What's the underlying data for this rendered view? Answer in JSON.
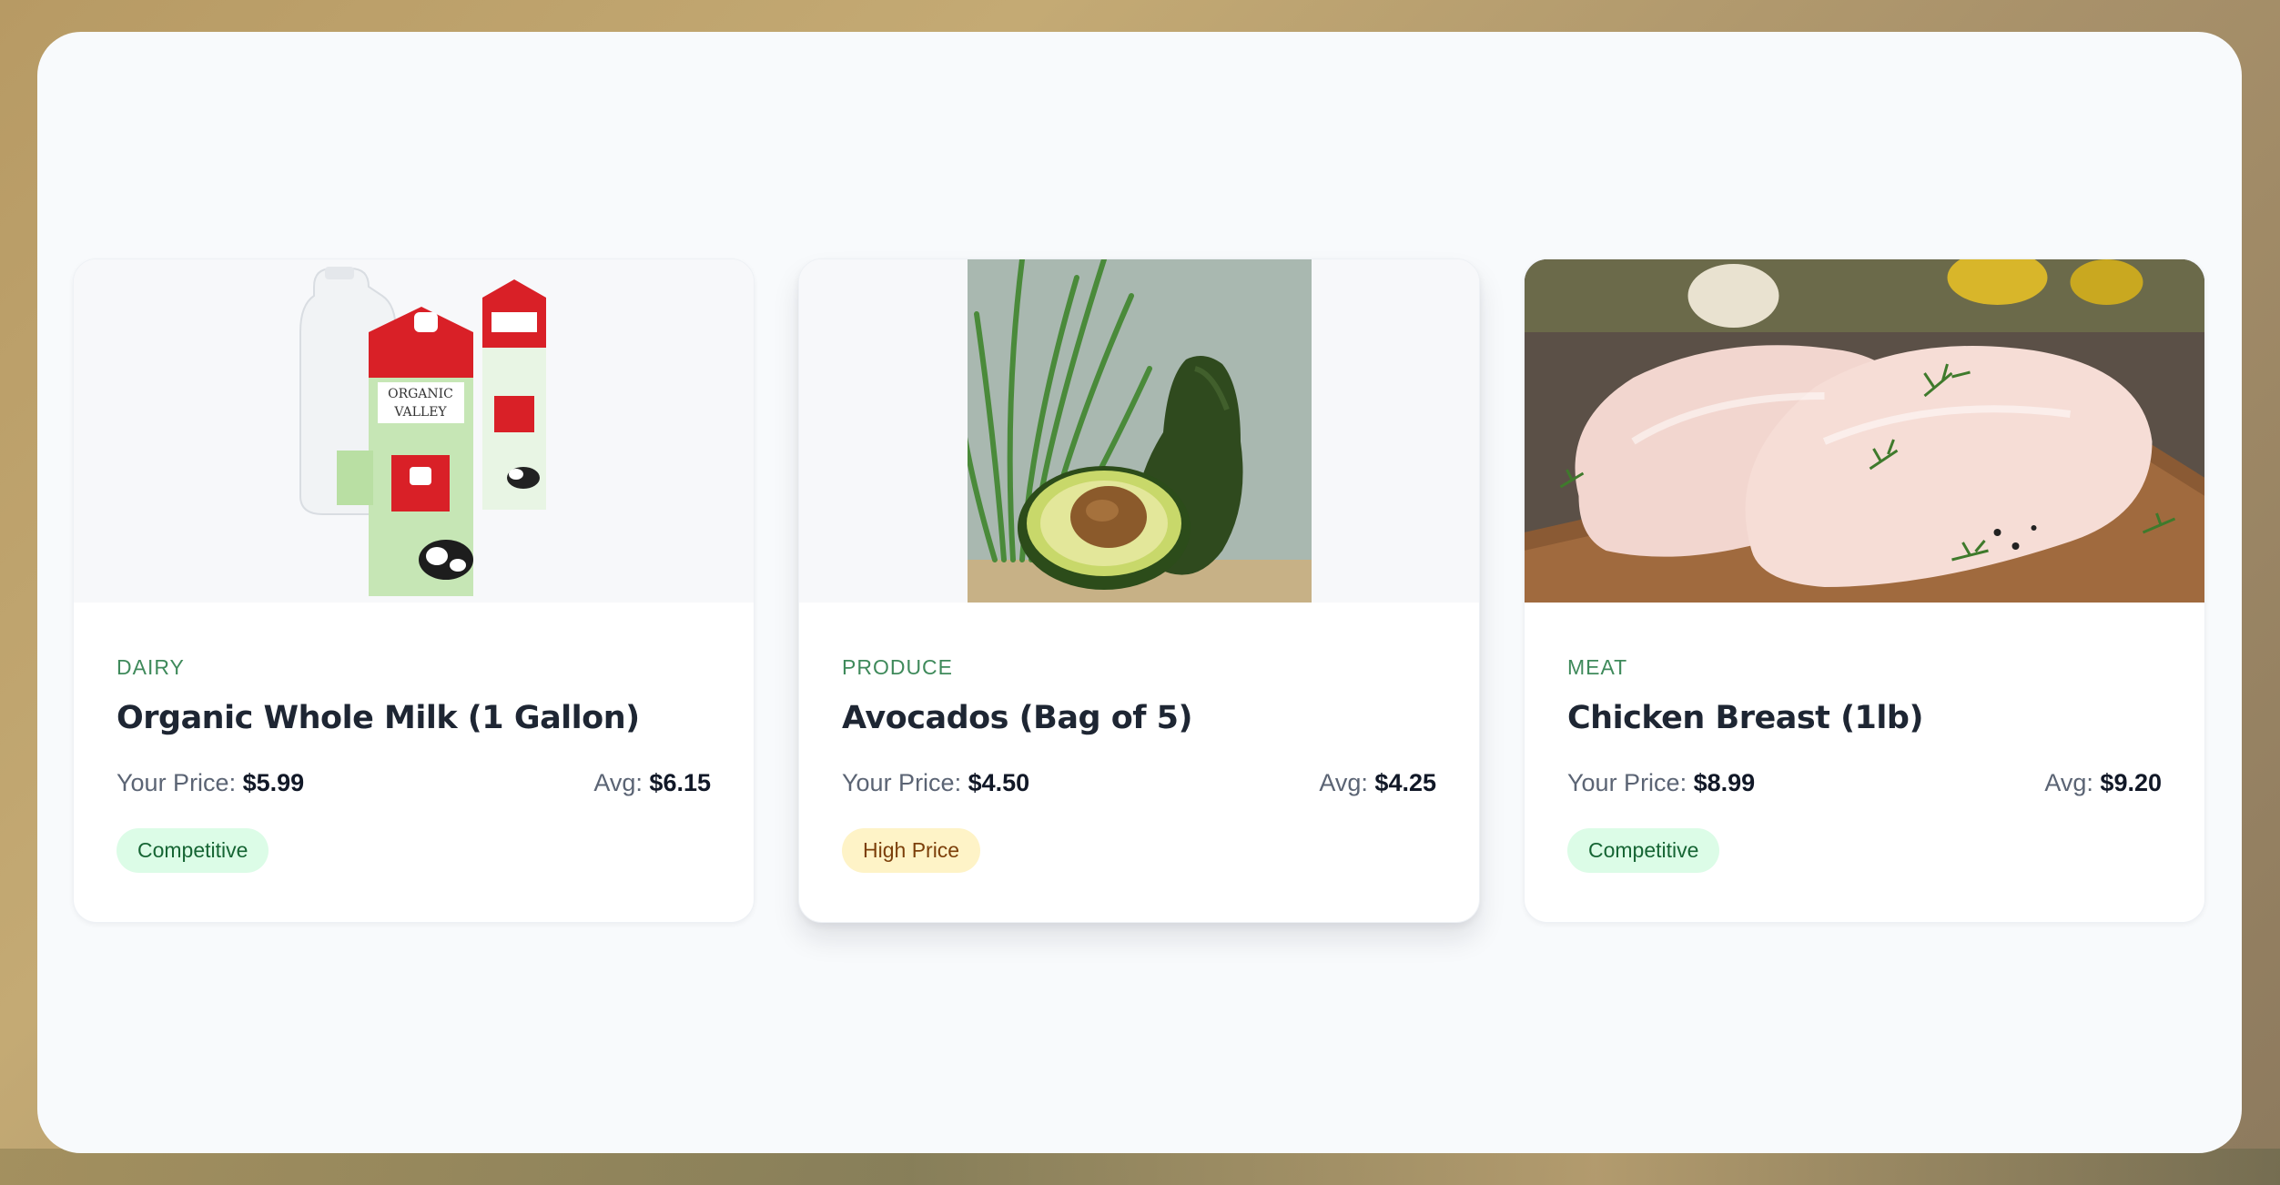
{
  "products": [
    {
      "category": "DAIRY",
      "name": "Organic Whole Milk (1 Gallon)",
      "your_price_label": "Your Price:",
      "your_price": "$5.99",
      "avg_label": "Avg:",
      "avg_price": "$6.15",
      "status": "Competitive",
      "image_icon": "milk-cartons-image"
    },
    {
      "category": "PRODUCE",
      "name": "Avocados (Bag of 5)",
      "your_price_label": "Your Price:",
      "your_price": "$4.50",
      "avg_label": "Avg:",
      "avg_price": "$4.25",
      "status": "High Price",
      "image_icon": "avocado-image"
    },
    {
      "category": "MEAT",
      "name": "Chicken Breast (1lb)",
      "your_price_label": "Your Price:",
      "your_price": "$8.99",
      "avg_label": "Avg:",
      "avg_price": "$9.20",
      "status": "Competitive",
      "image_icon": "chicken-breast-image"
    }
  ],
  "colors": {
    "category": "#3f8a5b",
    "competitive_bg": "#dcfce7",
    "competitive_text": "#166534",
    "high_price_bg": "#fef3c7",
    "high_price_text": "#7c3f0a"
  }
}
